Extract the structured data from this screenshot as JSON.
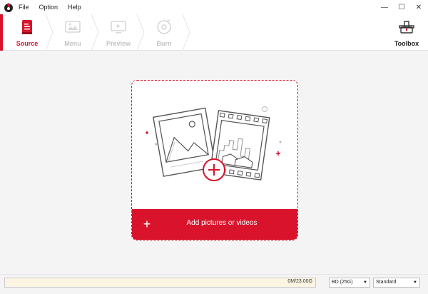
{
  "menu": {
    "items": [
      "File",
      "Option",
      "Help"
    ]
  },
  "window_controls": {
    "minimize": "—",
    "maximize": "☐",
    "close": "✕"
  },
  "steps": [
    {
      "label": "Source",
      "icon": "document-icon",
      "state": "active"
    },
    {
      "label": "Menu",
      "icon": "menu-template-icon",
      "state": "disabled"
    },
    {
      "label": "Preview",
      "icon": "preview-screen-icon",
      "state": "disabled"
    },
    {
      "label": "Burn",
      "icon": "disc-icon",
      "state": "disabled"
    }
  ],
  "toolbox": {
    "label": "Toolbox",
    "icon": "toolbox-icon"
  },
  "dropzone": {
    "add_label": "Add pictures or videos",
    "add_icon": "plus-icon"
  },
  "status": {
    "capacity_text": "0M/23.00G",
    "used_fraction": 0,
    "disc_type": "BD (25G)",
    "quality": "Standard"
  },
  "colors": {
    "accent": "#d8132b",
    "progress_bg": "#fcf5e3"
  }
}
